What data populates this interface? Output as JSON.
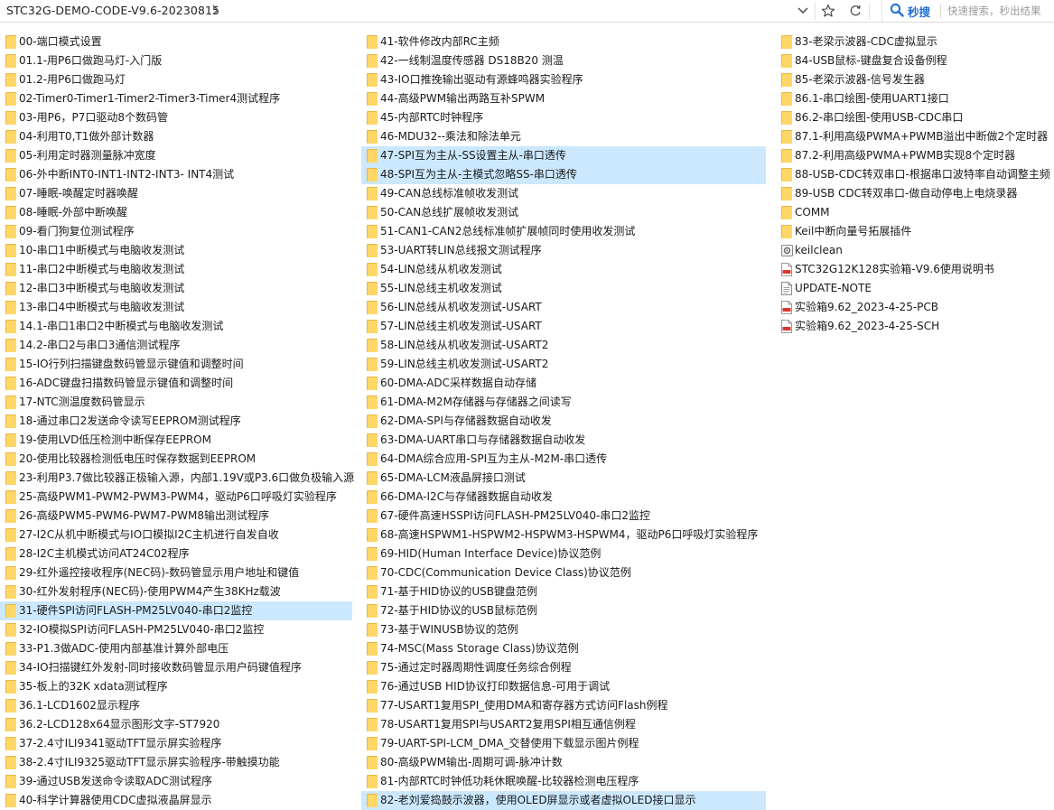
{
  "address_bar": {
    "path": "STC32G-DEMO-CODE-V9.6-20230815",
    "chevron": "chevron-right-icon",
    "dropdown": "chevron-down-icon"
  },
  "toolbar": {
    "favorite_icon": "star-icon",
    "refresh_icon": "refresh-icon"
  },
  "search": {
    "brand": "秒搜",
    "placeholder": "快速搜索，秒出结果"
  },
  "colors": {
    "selection": "#cce8ff",
    "folder": "#ffd766",
    "brand_blue": "#1f6fd8"
  },
  "columns": [
    {
      "items": [
        {
          "name": "00-端口模式设置",
          "type": "folder"
        },
        {
          "name": "01.1-用P6口做跑马灯-入门版",
          "type": "folder"
        },
        {
          "name": "01.2-用P6口做跑马灯",
          "type": "folder"
        },
        {
          "name": "02-Timer0-Timer1-Timer2-Timer3-Timer4测试程序",
          "type": "folder"
        },
        {
          "name": "03-用P6，P7口驱动8个数码管",
          "type": "folder"
        },
        {
          "name": "04-利用T0,T1做外部计数器",
          "type": "folder"
        },
        {
          "name": "05-利用定时器测量脉冲宽度",
          "type": "folder"
        },
        {
          "name": "06-外中断INT0-INT1-INT2-INT3- INT4测试",
          "type": "folder"
        },
        {
          "name": "07-睡眠-唤醒定时器唤醒",
          "type": "folder"
        },
        {
          "name": "08-睡眠-外部中断唤醒",
          "type": "folder"
        },
        {
          "name": "09-看门狗复位测试程序",
          "type": "folder"
        },
        {
          "name": "10-串口1中断模式与电脑收发测试",
          "type": "folder"
        },
        {
          "name": "11-串口2中断模式与电脑收发测试",
          "type": "folder"
        },
        {
          "name": "12-串口3中断模式与电脑收发测试",
          "type": "folder"
        },
        {
          "name": "13-串口4中断模式与电脑收发测试",
          "type": "folder"
        },
        {
          "name": "14.1-串口1串口2中断模式与电脑收发测试",
          "type": "folder"
        },
        {
          "name": "14.2-串口2与串口3通信测试程序",
          "type": "folder"
        },
        {
          "name": "15-IO行列扫描键盘数码管显示键值和调整时间",
          "type": "folder"
        },
        {
          "name": "16-ADC键盘扫描数码管显示键值和调整时间",
          "type": "folder"
        },
        {
          "name": "17-NTC测温度数码管显示",
          "type": "folder"
        },
        {
          "name": "18-通过串口2发送命令读写EEPROM测试程序",
          "type": "folder"
        },
        {
          "name": "19-使用LVD低压检测中断保存EEPROM",
          "type": "folder"
        },
        {
          "name": "20-使用比较器检测低电压时保存数据到EEPROM",
          "type": "folder"
        },
        {
          "name": "23-利用P3.7做比较器正极输入源，内部1.19V或P3.6口做负极输入源",
          "type": "folder"
        },
        {
          "name": "25-高级PWM1-PWM2-PWM3-PWM4，驱动P6口呼吸灯实验程序",
          "type": "folder"
        },
        {
          "name": "26-高级PWM5-PWM6-PWM7-PWM8输出测试程序",
          "type": "folder"
        },
        {
          "name": "27-I2C从机中断模式与IO口模拟I2C主机进行自发自收",
          "type": "folder"
        },
        {
          "name": "28-I2C主机模式访问AT24C02程序",
          "type": "folder"
        },
        {
          "name": "29-红外遥控接收程序(NEC码)-数码管显示用户地址和键值",
          "type": "folder"
        },
        {
          "name": "30-红外发射程序(NEC码)-使用PWM4产生38KHz载波",
          "type": "folder"
        },
        {
          "name": "31-硬件SPI访问FLASH-PM25LV040-串口2监控",
          "type": "folder",
          "selected": true
        },
        {
          "name": "32-IO模拟SPI访问FLASH-PM25LV040-串口2监控",
          "type": "folder"
        },
        {
          "name": "33-P1.3做ADC-使用内部基准计算外部电压",
          "type": "folder"
        },
        {
          "name": "34-IO扫描键红外发射-同时接收数码管显示用户码键值程序",
          "type": "folder"
        },
        {
          "name": "35-板上的32K xdata测试程序",
          "type": "folder"
        },
        {
          "name": "36.1-LCD1602显示程序",
          "type": "folder"
        },
        {
          "name": "36.2-LCD128x64显示图形文字-ST7920",
          "type": "folder"
        },
        {
          "name": "37-2.4寸ILI9341驱动TFT显示屏实验程序",
          "type": "folder"
        },
        {
          "name": "38-2.4寸ILI9325驱动TFT显示屏实验程序-带触摸功能",
          "type": "folder"
        },
        {
          "name": "39-通过USB发送命令读取ADC测试程序",
          "type": "folder"
        },
        {
          "name": "40-科学计算器使用CDC虚拟液晶屏显示",
          "type": "folder"
        }
      ]
    },
    {
      "items": [
        {
          "name": "41-软件修改内部RC主频",
          "type": "folder"
        },
        {
          "name": "42-一线制温度传感器 DS18B20 测温",
          "type": "folder"
        },
        {
          "name": "43-IO口推挽输出驱动有源蜂鸣器实验程序",
          "type": "folder"
        },
        {
          "name": "44-高级PWM输出两路互补SPWM",
          "type": "folder"
        },
        {
          "name": "45-内部RTC时钟程序",
          "type": "folder"
        },
        {
          "name": "46-MDU32--乘法和除法单元",
          "type": "folder"
        },
        {
          "name": "47-SPI互为主从-SS设置主从-串口透传",
          "type": "folder",
          "selected": true
        },
        {
          "name": "48-SPI互为主从-主模式忽略SS-串口透传",
          "type": "folder",
          "selected": true
        },
        {
          "name": "49-CAN总线标准帧收发测试",
          "type": "folder"
        },
        {
          "name": "50-CAN总线扩展帧收发测试",
          "type": "folder"
        },
        {
          "name": "51-CAN1-CAN2总线标准帧扩展帧同时使用收发测试",
          "type": "folder"
        },
        {
          "name": "53-UART转LIN总线报文测试程序",
          "type": "folder"
        },
        {
          "name": "54-LIN总线从机收发测试",
          "type": "folder"
        },
        {
          "name": "55-LIN总线主机收发测试",
          "type": "folder"
        },
        {
          "name": "56-LIN总线从机收发测试-USART",
          "type": "folder"
        },
        {
          "name": "57-LIN总线主机收发测试-USART",
          "type": "folder"
        },
        {
          "name": "58-LIN总线从机收发测试-USART2",
          "type": "folder"
        },
        {
          "name": "59-LIN总线主机收发测试-USART2",
          "type": "folder"
        },
        {
          "name": "60-DMA-ADC采样数据自动存储",
          "type": "folder"
        },
        {
          "name": "61-DMA-M2M存储器与存储器之间读写",
          "type": "folder"
        },
        {
          "name": "62-DMA-SPI与存储器数据自动收发",
          "type": "folder"
        },
        {
          "name": "63-DMA-UART串口与存储器数据自动收发",
          "type": "folder"
        },
        {
          "name": "64-DMA综合应用-SPI互为主从-M2M-串口透传",
          "type": "folder"
        },
        {
          "name": "65-DMA-LCM液晶屏接口测试",
          "type": "folder"
        },
        {
          "name": "66-DMA-I2C与存储器数据自动收发",
          "type": "folder"
        },
        {
          "name": "67-硬件高速HSSPI访问FLASH-PM25LV040-串口2监控",
          "type": "folder"
        },
        {
          "name": "68-高速HSPWM1-HSPWM2-HSPWM3-HSPWM4，驱动P6口呼吸灯实验程序",
          "type": "folder"
        },
        {
          "name": "69-HID(Human Interface Device)协议范例",
          "type": "folder"
        },
        {
          "name": "70-CDC(Communication Device Class)协议范例",
          "type": "folder"
        },
        {
          "name": "71-基于HID协议的USB键盘范例",
          "type": "folder"
        },
        {
          "name": "72-基于HID协议的USB鼠标范例",
          "type": "folder"
        },
        {
          "name": "73-基于WINUSB协议的范例",
          "type": "folder"
        },
        {
          "name": "74-MSC(Mass Storage Class)协议范例",
          "type": "folder"
        },
        {
          "name": "75-通过定时器周期性调度任务综合例程",
          "type": "folder"
        },
        {
          "name": "76-通过USB HID协议打印数据信息-可用于调试",
          "type": "folder"
        },
        {
          "name": "77-USART1复用SPI_使用DMA和寄存器方式访问Flash例程",
          "type": "folder"
        },
        {
          "name": "78-USART1复用SPI与USART2复用SPI相互通信例程",
          "type": "folder"
        },
        {
          "name": "79-UART-SPI-LCM_DMA_交替使用下载显示图片例程",
          "type": "folder"
        },
        {
          "name": "80-高级PWM输出-周期可调-脉冲计数",
          "type": "folder"
        },
        {
          "name": "81-内部RTC时钟低功耗休眠唤醒-比较器检测电压程序",
          "type": "folder"
        },
        {
          "name": "82-老刘爱捣鼓示波器，使用OLED屏显示或者虚拟OLED接口显示",
          "type": "folder",
          "selected": true
        }
      ]
    },
    {
      "items": [
        {
          "name": "83-老梁示波器-CDC虚拟显示",
          "type": "folder"
        },
        {
          "name": "84-USB鼠标-键盘复合设备例程",
          "type": "folder"
        },
        {
          "name": "85-老梁示波器-信号发生器",
          "type": "folder"
        },
        {
          "name": "86.1-串口绘图-使用UART1接口",
          "type": "folder"
        },
        {
          "name": "86.2-串口绘图-使用USB-CDC串口",
          "type": "folder"
        },
        {
          "name": "87.1-利用高级PWMA+PWMB溢出中断做2个定时器",
          "type": "folder"
        },
        {
          "name": "87.2-利用高级PWMA+PWMB实现8个定时器",
          "type": "folder"
        },
        {
          "name": "88-USB-CDC转双串口-根据串口波特率自动调整主频",
          "type": "folder"
        },
        {
          "name": "89-USB CDC转双串口-做自动停电上电烧录器",
          "type": "folder"
        },
        {
          "name": "COMM",
          "type": "folder"
        },
        {
          "name": "Keil中断向量号拓展插件",
          "type": "folder"
        },
        {
          "name": "keilclean",
          "type": "batch"
        },
        {
          "name": "STC32G12K128实验箱-V9.6使用说明书",
          "type": "pdf"
        },
        {
          "name": "UPDATE-NOTE",
          "type": "text"
        },
        {
          "name": "实验箱9.62_2023-4-25-PCB",
          "type": "pdf"
        },
        {
          "name": "实验箱9.62_2023-4-25-SCH",
          "type": "pdf"
        }
      ]
    }
  ]
}
